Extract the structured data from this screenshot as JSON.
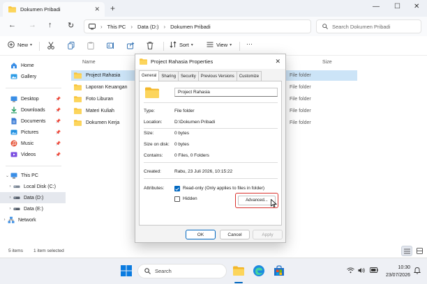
{
  "window": {
    "tab_title": "Dokumen Pribadi",
    "new_tab_symbol": "+",
    "close_tab_symbol": "✕"
  },
  "address": {
    "segments": [
      "This PC",
      "Data (D:)",
      "Dokumen Pribadi"
    ],
    "search_placeholder": "Search Dokumen Pribadi"
  },
  "commands": {
    "new_label": "New",
    "sort_label": "Sort",
    "view_label": "View",
    "more_label": "···"
  },
  "sidebar": {
    "items": [
      {
        "label": "Home",
        "icon": "home-icon"
      },
      {
        "label": "Gallery",
        "icon": "gallery-icon"
      },
      {
        "label": "Desktop",
        "icon": "desktop-icon"
      },
      {
        "label": "Downloads",
        "icon": "downloads-icon"
      },
      {
        "label": "Documents",
        "icon": "documents-icon"
      },
      {
        "label": "Pictures",
        "icon": "pictures-icon"
      },
      {
        "label": "Music",
        "icon": "music-icon"
      },
      {
        "label": "Videos",
        "icon": "videos-icon"
      },
      {
        "label": "This PC",
        "icon": "pc-icon"
      },
      {
        "label": "Local Disk (C:)",
        "icon": "drive-icon"
      },
      {
        "label": "Data (D:)",
        "icon": "drive-icon"
      },
      {
        "label": "Data (E:)",
        "icon": "drive-icon"
      },
      {
        "label": "Network",
        "icon": "network-icon"
      }
    ]
  },
  "list": {
    "columns": {
      "name": "Name",
      "size": "Size"
    },
    "rows": [
      {
        "name": "Project Rahasia",
        "type": "File folder"
      },
      {
        "name": "Laporan Keuangan",
        "type": "File folder"
      },
      {
        "name": "Foto Liburan",
        "type": "File folder"
      },
      {
        "name": "Materi Kuliah",
        "type": "File folder"
      },
      {
        "name": "Dokumen Kerja",
        "type": "File folder"
      }
    ]
  },
  "status": {
    "items": "5 items",
    "selected": "1 item selected"
  },
  "dialog": {
    "title": "Project Rahasia Properties",
    "tabs": [
      "General",
      "Sharing",
      "Security",
      "Previous Versions",
      "Customize"
    ],
    "folder_name": "Project Rahasia",
    "props": {
      "type_label": "Type:",
      "type_value": "File folder",
      "location_label": "Location:",
      "location_value": "D:\\Dokumen Pribadi",
      "size_label": "Size:",
      "size_value": "0 bytes",
      "size_on_disk_label": "Size on disk:",
      "size_on_disk_value": "0 bytes",
      "contains_label": "Contains:",
      "contains_value": "0 Files, 0 Folders",
      "created_label": "Created:",
      "created_value": "Rabu, 23 Juli 2026, 10:15:22",
      "attributes_label": "Attributes:"
    },
    "readonly_label": "Read-only (Only applies to files in folder)",
    "hidden_label": "Hidden",
    "readonly_checked": true,
    "hidden_checked": false,
    "advanced_label": "Advanced...",
    "ok_label": "OK",
    "cancel_label": "Cancel",
    "apply_label": "Apply"
  },
  "taskbar": {
    "search_placeholder": "Search",
    "time": "10:30",
    "date": "23/07/2026"
  },
  "colors": {
    "accent": "#0067c0",
    "folder": "#f8c33a",
    "selection": "#cce4f7",
    "highlight": "#d9302c"
  }
}
